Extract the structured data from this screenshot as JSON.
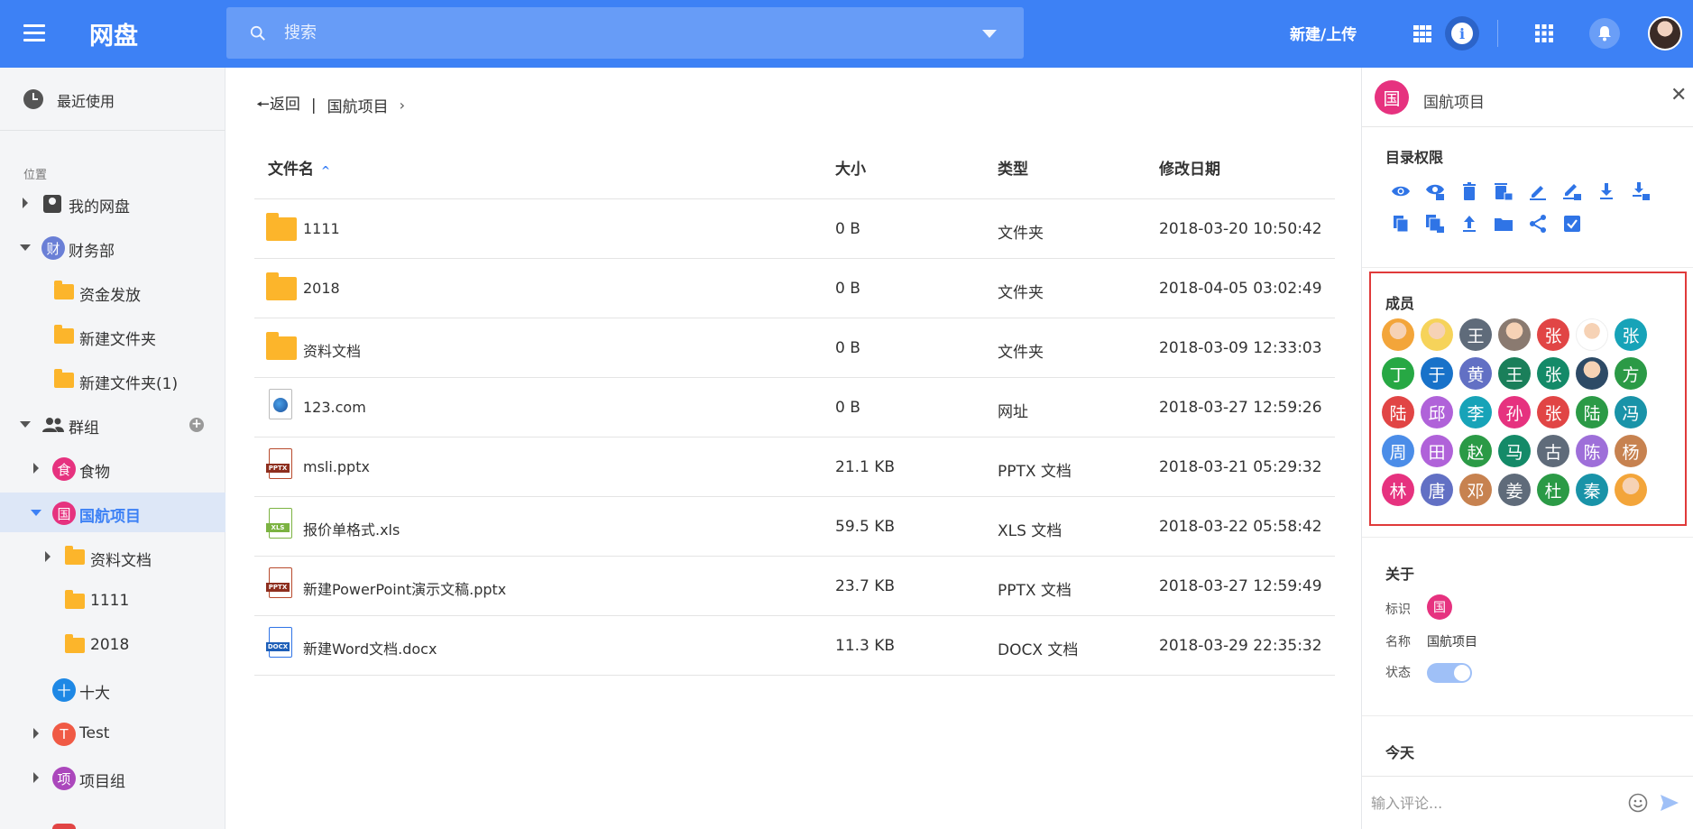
{
  "app": {
    "title": "网盘"
  },
  "search": {
    "placeholder": "搜索"
  },
  "topbar": {
    "new_upload": "新建/上传"
  },
  "sidebar": {
    "recent": "最近使用",
    "location_label": "位置",
    "items": [
      {
        "label": "我的网盘"
      },
      {
        "label": "财务部",
        "icon_text": "财",
        "color": "#6a7fd6"
      },
      {
        "label": "资金发放"
      },
      {
        "label": "新建文件夹"
      },
      {
        "label": "新建文件夹(1)"
      },
      {
        "label": "群组"
      },
      {
        "label": "食物",
        "icon_text": "食",
        "color": "#e6327f"
      },
      {
        "label": "国航项目",
        "icon_text": "国",
        "color": "#e6327f"
      },
      {
        "label": "资料文档"
      },
      {
        "label": "1111"
      },
      {
        "label": "2018"
      },
      {
        "label": "十大",
        "icon_text": "十",
        "color": "#1e88e5"
      },
      {
        "label": "Test",
        "icon_text": "T",
        "color": "#f05a45"
      },
      {
        "label": "项目组",
        "icon_text": "项",
        "color": "#ab47bc"
      }
    ]
  },
  "breadcrumb": {
    "back": "返回",
    "current": "国航项目"
  },
  "table": {
    "headers": {
      "name": "文件名",
      "size": "大小",
      "type": "类型",
      "date": "修改日期"
    },
    "rows": [
      {
        "name": "1111",
        "size": "0 B",
        "type": "文件夹",
        "date": "2018-03-20 10:50:42",
        "kind": "folder"
      },
      {
        "name": "2018",
        "size": "0 B",
        "type": "文件夹",
        "date": "2018-04-05 03:02:49",
        "kind": "folder"
      },
      {
        "name": "资料文档",
        "size": "0 B",
        "type": "文件夹",
        "date": "2018-03-09 12:33:03",
        "kind": "folder"
      },
      {
        "name": "123.com",
        "size": "0 B",
        "type": "网址",
        "date": "2018-03-27 12:59:26",
        "kind": "url"
      },
      {
        "name": "msli.pptx",
        "size": "21.1 KB",
        "type": "PPTX 文档",
        "date": "2018-03-21 05:29:32",
        "kind": "pptx",
        "tag": "PPTX"
      },
      {
        "name": "报价单格式.xls",
        "size": "59.5 KB",
        "type": "XLS 文档",
        "date": "2018-03-22 05:58:42",
        "kind": "xls",
        "tag": "XLS"
      },
      {
        "name": "新建PowerPoint演示文稿.pptx",
        "size": "23.7 KB",
        "type": "PPTX 文档",
        "date": "2018-03-27 12:59:49",
        "kind": "pptx",
        "tag": "PPTX"
      },
      {
        "name": "新建Word文档.docx",
        "size": "11.3 KB",
        "type": "DOCX 文档",
        "date": "2018-03-29 22:35:32",
        "kind": "docx",
        "tag": "DOCX"
      }
    ]
  },
  "panel": {
    "icon_text": "国",
    "title": "国航项目",
    "permissions_title": "目录权限",
    "members_title": "成员",
    "members": [
      {
        "text": "",
        "color": "#f3a53a"
      },
      {
        "text": "",
        "color": "#f6d35a"
      },
      {
        "text": "王",
        "color": "#5f6b7a"
      },
      {
        "text": "",
        "color": "#8a7a70"
      },
      {
        "text": "张",
        "color": "#e14545"
      },
      {
        "text": "",
        "color": "#ffffff"
      },
      {
        "text": "张",
        "color": "#17a3b8"
      },
      {
        "text": "丁",
        "color": "#27a844"
      },
      {
        "text": "于",
        "color": "#1872c9"
      },
      {
        "text": "黄",
        "color": "#6270c4"
      },
      {
        "text": "王",
        "color": "#1a7f5a"
      },
      {
        "text": "张",
        "color": "#148a68"
      },
      {
        "text": "",
        "color": "#2d4a66"
      },
      {
        "text": "方",
        "color": "#2b9a46"
      },
      {
        "text": "陆",
        "color": "#e14545"
      },
      {
        "text": "邱",
        "color": "#b062d9"
      },
      {
        "text": "李",
        "color": "#17a3b8"
      },
      {
        "text": "孙",
        "color": "#e6327f"
      },
      {
        "text": "张",
        "color": "#e14545"
      },
      {
        "text": "陆",
        "color": "#2b9a46"
      },
      {
        "text": "冯",
        "color": "#1993a8"
      },
      {
        "text": "周",
        "color": "#4b8de8"
      },
      {
        "text": "田",
        "color": "#b062d9"
      },
      {
        "text": "赵",
        "color": "#2b9a46"
      },
      {
        "text": "马",
        "color": "#148a68"
      },
      {
        "text": "古",
        "color": "#5f6b7a"
      },
      {
        "text": "陈",
        "color": "#9e6fd9"
      },
      {
        "text": "杨",
        "color": "#c78250"
      },
      {
        "text": "林",
        "color": "#e6327f"
      },
      {
        "text": "唐",
        "color": "#6270c4"
      },
      {
        "text": "邓",
        "color": "#c78250"
      },
      {
        "text": "姜",
        "color": "#5f6b7a"
      },
      {
        "text": "杜",
        "color": "#2b9a46"
      },
      {
        "text": "秦",
        "color": "#1993a8"
      },
      {
        "text": "",
        "color": "#f3a53a"
      }
    ],
    "about_title": "关于",
    "about": {
      "id_label": "标识",
      "id_text": "国",
      "name_label": "名称",
      "name_value": "国航项目",
      "status_label": "状态",
      "status_on": true
    },
    "today_title": "今天",
    "comment_placeholder": "输入评论..."
  },
  "colors": {
    "accent": "#3d81f5",
    "folder": "#fcb52b"
  }
}
